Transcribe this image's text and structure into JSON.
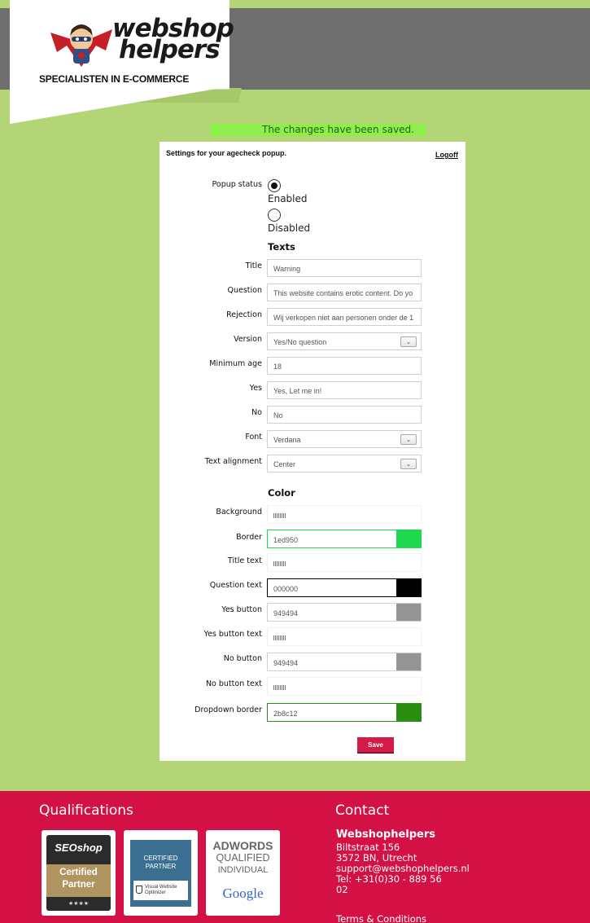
{
  "header": {
    "brand": "webshop helpers",
    "brand_line1": "webshop",
    "brand_line2": "helpers",
    "tagline": "SPECIALISTEN IN E-COMMERCE"
  },
  "status_message": "The changes have been saved.",
  "panel": {
    "title": "Settings for your agecheck popup.",
    "logoff": "Logoff",
    "popup_status": {
      "label": "Popup status",
      "options": [
        {
          "label": "Enabled",
          "selected": true
        },
        {
          "label": "Disabled",
          "selected": false
        }
      ]
    },
    "texts_heading": "Texts",
    "fields": [
      {
        "label": "Title",
        "value": "Warning"
      },
      {
        "label": "Question",
        "value": "This website contains erotic content. Do yo"
      },
      {
        "label": "Rejection",
        "value": "Wij verkopen niet aan personen onder de 1"
      },
      {
        "label": "Version",
        "value": "Yes/No question",
        "select": true
      },
      {
        "label": "Minimum age",
        "value": "18"
      },
      {
        "label": "Yes",
        "value": "Yes, Let me in!"
      },
      {
        "label": "No",
        "value": "No"
      },
      {
        "label": "Font",
        "value": "Verdana",
        "select": true
      },
      {
        "label": "Text alignment",
        "value": "Center",
        "select": true
      }
    ],
    "color_heading": "Color",
    "colors": [
      {
        "label": "Background",
        "value": "",
        "swatch": ""
      },
      {
        "label": "Border",
        "value": "1ed950",
        "swatch": "#1ed950"
      },
      {
        "label": "Title text",
        "value": "",
        "swatch": ""
      },
      {
        "label": "Question text",
        "value": "000000",
        "swatch": "#000000"
      },
      {
        "label": "Yes button",
        "value": "949494",
        "swatch": "#949494"
      },
      {
        "label": "Yes button text",
        "value": "",
        "swatch": ""
      },
      {
        "label": "No button",
        "value": "949494",
        "swatch": "#949494"
      },
      {
        "label": "No button text",
        "value": "",
        "swatch": ""
      },
      {
        "label": "Dropdown border",
        "value": "2b8c12",
        "swatch": "#2b8c12"
      }
    ],
    "save_label": "Save"
  },
  "footer": {
    "qualifications_title": "Qualifications",
    "badges": {
      "seoshop": {
        "brand": "SEOshop",
        "line1": "Certified",
        "line2": "Partner",
        "stars": "★★★★"
      },
      "vwo": {
        "line1": "CERTIFIED",
        "line2": "PARTNER",
        "sub": "Visual Website Optimizer"
      },
      "adwords": {
        "line1": "ADWORDS",
        "line2": "QUALIFIED",
        "line3": "INDIVIDUAL",
        "google": "Google"
      }
    },
    "contact_title": "Contact",
    "company": "Webshophelpers",
    "address1": "Biltstraat 156",
    "address2": "3572 BN, Utrecht",
    "email": "support@webshophelpers.nl",
    "phone_line1": "Tel: +31(0)30 - 889 56",
    "phone_line2": "02",
    "terms": "Terms & Conditions"
  },
  "colors": {
    "page_bg": "#b4d576",
    "header_bar": "#6f6f6f",
    "footer_bg": "#d31145",
    "save_button": "#d31a48",
    "saved_bar": "#8cef4c"
  }
}
